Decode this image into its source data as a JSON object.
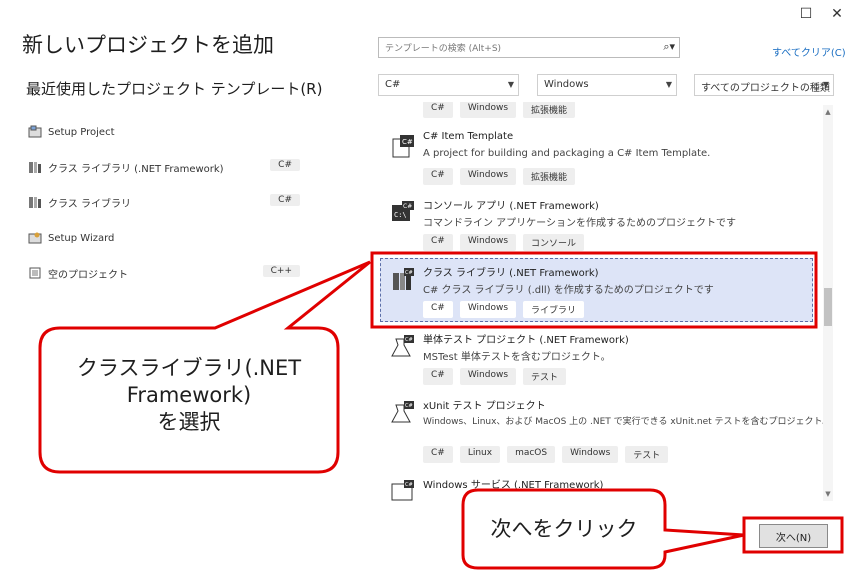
{
  "window": {
    "title": "新しいプロジェクトを追加",
    "maximize_glyph": "☐",
    "close_glyph": "✕"
  },
  "recent": {
    "title": "最近使用したプロジェクト テンプレート(R)",
    "items": [
      {
        "label": "Setup Project",
        "tag": "",
        "icon": "setup-project-icon"
      },
      {
        "label": "クラス ライブラリ (.NET Framework)",
        "tag": "C#",
        "icon": "class-library-icon"
      },
      {
        "label": "クラス ライブラリ",
        "tag": "C#",
        "icon": "class-library-icon"
      },
      {
        "label": "Setup Wizard",
        "tag": "",
        "icon": "setup-wizard-icon"
      },
      {
        "label": "空のプロジェクト",
        "tag": "C++",
        "icon": "empty-project-icon"
      }
    ]
  },
  "search": {
    "placeholder": "テンプレートの検索 (Alt+S)",
    "icon": "search-icon"
  },
  "clear_all": "すべてクリア(C)",
  "filters": {
    "language": "C#",
    "platform": "Windows",
    "project_type": "すべてのプロジェクトの種類"
  },
  "templates": [
    {
      "name": "",
      "desc": "",
      "tags": [
        "C#",
        "Windows",
        "拡張機能"
      ]
    },
    {
      "name": "C# Item Template",
      "desc": "A project for building and packaging a C# Item Template.",
      "tags": [
        "C#",
        "Windows",
        "拡張機能"
      ]
    },
    {
      "name": "コンソール アプリ (.NET Framework)",
      "desc": "コマンドライン アプリケーションを作成するためのプロジェクトです",
      "tags": [
        "C#",
        "Windows",
        "コンソール"
      ]
    },
    {
      "name": "クラス ライブラリ (.NET Framework)",
      "desc": "C# クラス ライブラリ (.dll) を作成するためのプロジェクトです",
      "tags": [
        "C#",
        "Windows",
        "ライブラリ"
      ]
    },
    {
      "name": "単体テスト プロジェクト (.NET Framework)",
      "desc": "MSTest 単体テストを含むプロジェクト。",
      "tags": [
        "C#",
        "Windows",
        "テスト"
      ]
    },
    {
      "name": "xUnit テスト プロジェクト",
      "desc": "Windows、Linux、および MacOS 上の .NET で実行できる xUnit.net テストを含むプロジェクト。",
      "tags": [
        "C#",
        "Linux",
        "macOS",
        "Windows",
        "テスト"
      ]
    },
    {
      "name": "Windows サービス (.NET Framework)",
      "desc": "",
      "tags": []
    }
  ],
  "next_button": "次へ(N)",
  "callouts": {
    "select_line1": "クラスライブラリ(.NET",
    "select_line2": "Framework)",
    "select_line3": "を選択",
    "next": "次へをクリック"
  },
  "colors": {
    "callout_red": "#e00000",
    "selection_bg": "#dde4f7",
    "link_blue": "#1a6ec2"
  }
}
